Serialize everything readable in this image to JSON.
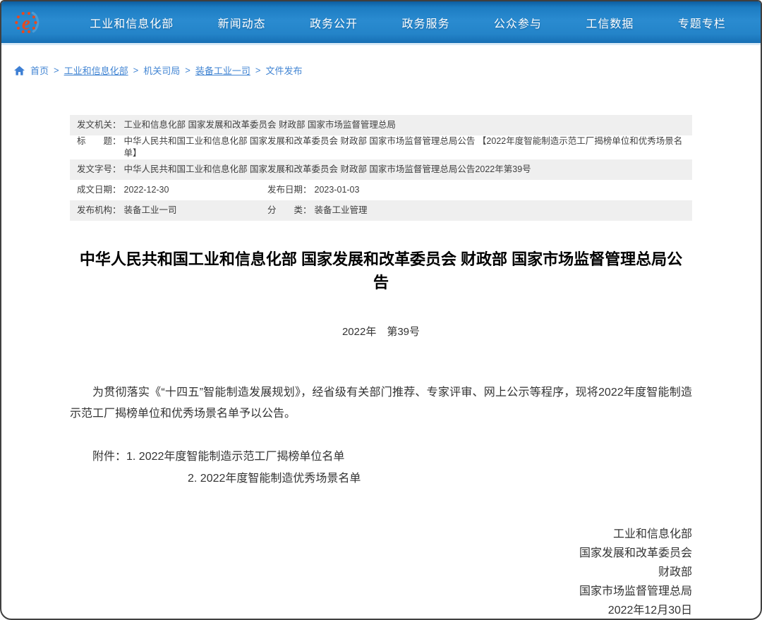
{
  "colors": {
    "nav_blue": "#2484c9",
    "breadcrumb_blue": "#4285d3",
    "logo_orange": "#e8491d",
    "logo_swoosh_blue": "#4a9bd5",
    "meta_row_gray": "#efefef"
  },
  "nav": {
    "items": [
      {
        "label": "工业和信息化部"
      },
      {
        "label": "新闻动态"
      },
      {
        "label": "政务公开"
      },
      {
        "label": "政务服务"
      },
      {
        "label": "公众参与"
      },
      {
        "label": "工信数据"
      },
      {
        "label": "专题专栏"
      }
    ]
  },
  "breadcrumb": {
    "separator": ">",
    "items": [
      "首页",
      "工业和信息化部",
      "机关司局",
      "装备工业一司",
      "文件发布"
    ]
  },
  "meta": {
    "rows": [
      {
        "cells": [
          {
            "label": "发文机关：",
            "value": "工业和信息化部 国家发展和改革委员会 财政部 国家市场监督管理总局"
          }
        ]
      },
      {
        "cells": [
          {
            "label": "标　　题：",
            "value": "中华人民共和国工业和信息化部 国家发展和改革委员会 财政部 国家市场监督管理总局公告 【2022年度智能制造示范工厂揭榜单位和优秀场景名单】"
          }
        ]
      },
      {
        "cells": [
          {
            "label": "发文字号：",
            "value": "中华人民共和国工业和信息化部 国家发展和改革委员会 财政部 国家市场监督管理总局公告2022年第39号"
          }
        ]
      },
      {
        "cells": [
          {
            "label": "成文日期：",
            "value": "2022-12-30"
          },
          {
            "label": "发布日期：",
            "value": "2023-01-03"
          }
        ]
      },
      {
        "cells": [
          {
            "label": "发布机构：",
            "value": "装备工业一司"
          },
          {
            "label": "分　　类：",
            "value": "装备工业管理"
          }
        ]
      }
    ]
  },
  "doc": {
    "title": "中华人民共和国工业和信息化部 国家发展和改革委员会 财政部 国家市场监督管理总局公告",
    "issue_no": "2022年　第39号",
    "paragraph": "为贯彻落实《“十四五”智能制造发展规划》，经省级有关部门推荐、专家评审、网上公示等程序，现将2022年度智能制造示范工厂揭榜单位和优秀场景名单予以公告。",
    "attachments_label": "附件：",
    "attachments": [
      "1. 2022年度智能制造示范工厂揭榜单位名单",
      "2. 2022年度智能制造优秀场景名单"
    ],
    "signatures": [
      "工业和信息化部",
      "国家发展和改革委员会",
      "财政部",
      "国家市场监督管理总局"
    ],
    "date": "2022年12月30日"
  }
}
